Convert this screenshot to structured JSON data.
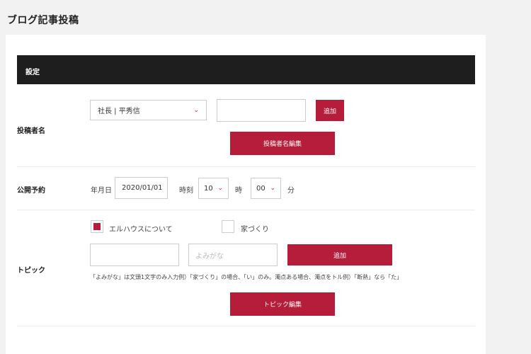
{
  "page": {
    "title": "ブログ記事投稿"
  },
  "settings": {
    "header": "設定",
    "author": {
      "label": "投稿者名",
      "select_value": "社長 | 平秀信",
      "new_author_value": "",
      "add_label": "追加",
      "edit_label": "投稿者名編集"
    },
    "schedule": {
      "label": "公開予約",
      "date_label": "年月日",
      "date_value": "2020/01/01",
      "time_label": "時刻",
      "hour_value": "10",
      "hour_unit": "時",
      "minute_value": "00",
      "minute_unit": "分"
    },
    "topic": {
      "label": "トピック",
      "options": [
        {
          "label": "エルハウスについて",
          "checked": true
        },
        {
          "label": "家づくり",
          "checked": false
        }
      ],
      "name_value": "",
      "reading_placeholder": "よみがな",
      "add_label": "追加",
      "hint": "「よみがな」は文頭1文字のみ入力例）「家づくり」の場合、「い」のみ。濁点ある場合、濁点をトル例）「断熱」なら「た」",
      "edit_label": "トピック編集"
    }
  }
}
